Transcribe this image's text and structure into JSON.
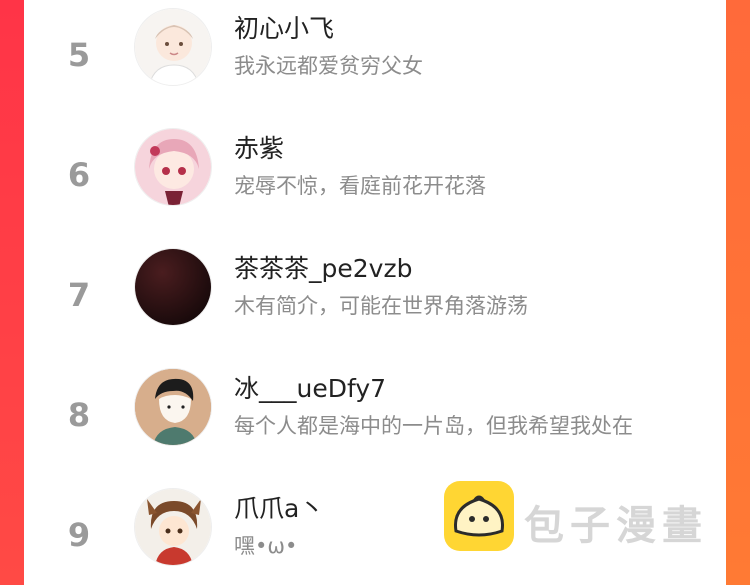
{
  "ranking": {
    "rows": [
      {
        "rank": "5",
        "name": "初心小飞",
        "bio": "我永远都爱贫穷父女"
      },
      {
        "rank": "6",
        "name": "赤紫",
        "bio": "宠辱不惊，看庭前花开花落"
      },
      {
        "rank": "7",
        "name": "茶茶茶_pe2vzb",
        "bio": "木有简介，可能在世界角落游荡"
      },
      {
        "rank": "8",
        "name": "冰___ueDfy7",
        "bio": "每个人都是海中的一片岛，但我希望我处在"
      },
      {
        "rank": "9",
        "name": "爪爪a丶",
        "bio": "嘿•ω•"
      }
    ]
  },
  "watermark": {
    "text": "包子漫畫"
  },
  "colors": {
    "accent_left": "#ff3447",
    "accent_right": "#ff7a34",
    "rank_gray": "#9a9a9a",
    "logo_yellow": "#ffd633"
  }
}
